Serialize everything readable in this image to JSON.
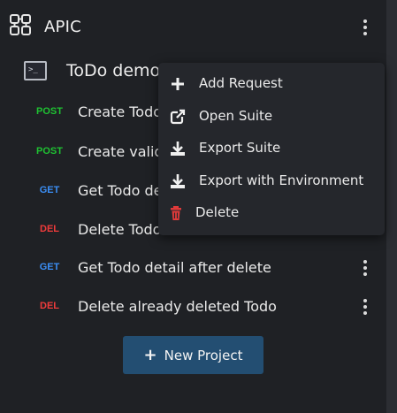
{
  "app": {
    "title": "APIC"
  },
  "suite": {
    "name": "ToDo demo"
  },
  "requests": [
    {
      "method": "POST",
      "name": "Create Todo"
    },
    {
      "method": "POST",
      "name": "Create validation"
    },
    {
      "method": "GET",
      "name": "Get Todo detail"
    },
    {
      "method": "DEL",
      "name": "Delete Todo"
    },
    {
      "method": "GET",
      "name": "Get Todo detail after delete"
    },
    {
      "method": "DEL",
      "name": "Delete already deleted Todo"
    }
  ],
  "new_project": {
    "label": "New Project"
  },
  "context_menu": {
    "items": [
      {
        "label": "Add Request",
        "icon": "plus-icon"
      },
      {
        "label": "Open Suite",
        "icon": "external-link-icon"
      },
      {
        "label": "Export Suite",
        "icon": "download-icon"
      },
      {
        "label": "Export with Environment",
        "icon": "download-icon"
      },
      {
        "label": "Delete",
        "icon": "trash-icon"
      }
    ]
  },
  "colors": {
    "post": "#1fc232",
    "get": "#3b8ef5",
    "del": "#ef3b3b",
    "button": "#234e72",
    "background": "#1f2125"
  }
}
